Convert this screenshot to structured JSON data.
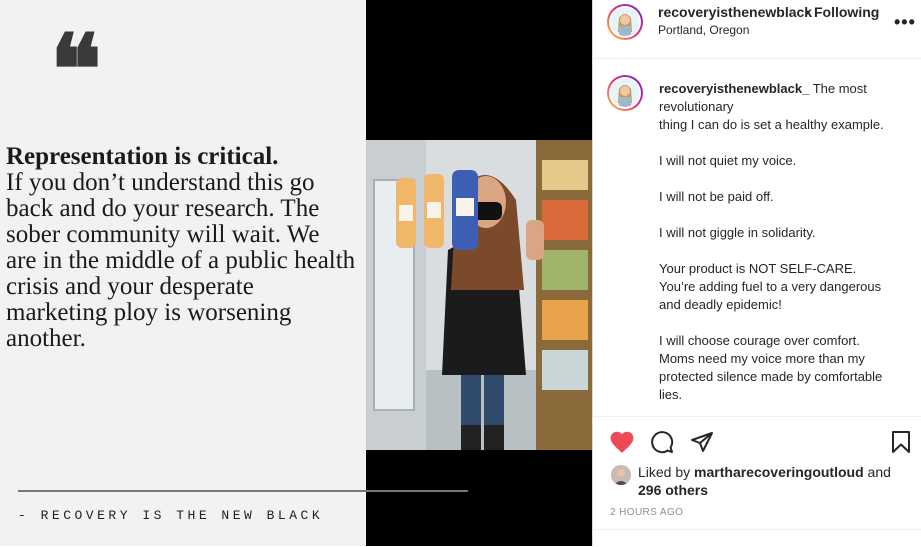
{
  "post": {
    "quote_heading": "Representation is critical.",
    "quote_body": "If you don’t understand this go back and do your research. The sober community will wait. We are in the middle of a public health crisis and your desperate marketing ploy is worsening another.",
    "signature": "- RECOVERY IS THE NEW BLACK"
  },
  "header": {
    "username": "recoveryisthenewblack",
    "separator": "•",
    "follow_status": "Following",
    "location": "Portland, Oregon",
    "more_icon": "more-horizontal-icon"
  },
  "caption": {
    "username": "recoveryisthenewblack_",
    "text": " The most revolutionary\nthing I can do is set a healthy example.\n\nI will not quiet my voice.\n\nI will not be paid off.\n\nI will not giggle in solidarity.\n\nYour product is NOT SELF-CARE.\nYou’re adding fuel to a very dangerous and deadly epidemic!\n\nI will choose courage over comfort.\nMoms need my voice more than my protected silence made by comfortable lies."
  },
  "actions": {
    "like_icon": "heart-filled-icon",
    "comment_icon": "comment-icon",
    "share_icon": "paper-plane-icon",
    "save_icon": "bookmark-icon",
    "like_color": "#ed4956"
  },
  "likes": {
    "prefix": "Liked by ",
    "user": "martharecoveringoutloud",
    "and": " and",
    "others": "296 others"
  },
  "time": "2 HOURS AGO"
}
